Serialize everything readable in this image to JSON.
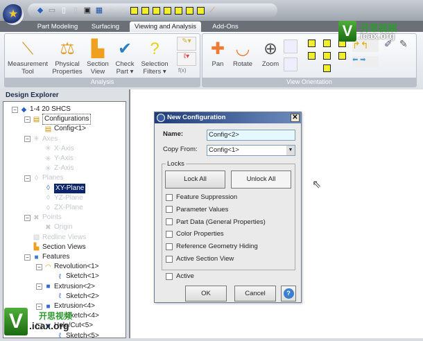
{
  "tabs": [
    {
      "label": "Part Modeling"
    },
    {
      "label": "Surfacing"
    },
    {
      "label": "Viewing and Analysis",
      "active": true
    },
    {
      "label": "Add-Ons"
    }
  ],
  "ribbon": {
    "analysis": {
      "label": "Analysis",
      "buttons": [
        {
          "label": "Measurement Tool",
          "icon": "ruler-icon"
        },
        {
          "label": "Physical Properties",
          "icon": "scale-icon"
        },
        {
          "label": "Section View",
          "icon": "section-view-icon"
        },
        {
          "label": "Check Part ▾",
          "icon": "check-part-icon"
        },
        {
          "label": "Selection Filters ▾",
          "icon": "question-icon"
        }
      ],
      "fx": "f(x)"
    },
    "view": {
      "label": "View Orientation",
      "buttons": [
        {
          "label": "Pan",
          "icon": "pan-icon"
        },
        {
          "label": "Rotate",
          "icon": "rotate-icon"
        },
        {
          "label": "Zoom",
          "icon": "zoom-icon"
        }
      ]
    }
  },
  "explorer": {
    "title": "Design Explorer",
    "items": [
      {
        "label": "1-4 20 SHCS",
        "level": 0,
        "icon": "part-icon"
      },
      {
        "label": "Configurations",
        "level": 1,
        "icon": "table-icon",
        "boxed": true
      },
      {
        "label": "Config<1>",
        "level": 2,
        "icon": "table-icon"
      },
      {
        "label": "Axes",
        "level": 1,
        "icon": "axis-icon",
        "dim": true
      },
      {
        "label": "X-Axis",
        "level": 2,
        "icon": "axis-icon",
        "dim": true
      },
      {
        "label": "Y-Axis",
        "level": 2,
        "icon": "axis-icon",
        "dim": true
      },
      {
        "label": "Z-Axis",
        "level": 2,
        "icon": "axis-icon",
        "dim": true
      },
      {
        "label": "Planes",
        "level": 1,
        "icon": "plane-icon",
        "dim": true
      },
      {
        "label": "XY-Plane",
        "level": 2,
        "icon": "plane-icon",
        "selected": true
      },
      {
        "label": "YZ-Plane",
        "level": 2,
        "icon": "plane-icon",
        "dim": true
      },
      {
        "label": "ZX-Plane",
        "level": 2,
        "icon": "plane-icon",
        "dim": true
      },
      {
        "label": "Points",
        "level": 1,
        "icon": "point-icon",
        "dim": true
      },
      {
        "label": "Origin",
        "level": 2,
        "icon": "point-icon",
        "dim": true
      },
      {
        "label": "Redline Views",
        "level": 1,
        "icon": "redline-icon",
        "dim": true
      },
      {
        "label": "Section Views",
        "level": 1,
        "icon": "section-icon"
      },
      {
        "label": "Features",
        "level": 1,
        "icon": "features-icon"
      },
      {
        "label": "Revolution<1>",
        "level": 2,
        "icon": "revolution-icon"
      },
      {
        "label": "Sketch<1>",
        "level": 3,
        "icon": "sketch-icon"
      },
      {
        "label": "Extrusion<2>",
        "level": 2,
        "icon": "extrusion-icon"
      },
      {
        "label": "Sketch<2>",
        "level": 3,
        "icon": "sketch-icon"
      },
      {
        "label": "Extrusion<4>",
        "level": 2,
        "icon": "extrusion-icon"
      },
      {
        "label": "Sketch<4>",
        "level": 3,
        "icon": "sketch-icon"
      },
      {
        "label": "Hole/Cut<5>",
        "level": 2,
        "icon": "hole-icon"
      },
      {
        "label": "Sketch<5>",
        "level": 3,
        "icon": "sketch-icon"
      }
    ]
  },
  "dialog": {
    "title": "New Configuration",
    "close": "✕",
    "name_label": "Name:",
    "name_value": "Config<2>",
    "copy_from_label": "Copy From:",
    "copy_from_value": "Config<1>",
    "locks_label": "Locks",
    "lock_all": "Lock All",
    "unlock_all": "Unlock All",
    "checks": [
      {
        "label": "Feature Suppression",
        "checked": false
      },
      {
        "label": "Parameter Values",
        "checked": false
      },
      {
        "label": "Part Data (General Properties)",
        "checked": false
      },
      {
        "label": "Color Properties",
        "checked": false
      },
      {
        "label": "Reference Geometry Hiding",
        "checked": false
      },
      {
        "label": "Active Section View",
        "checked": false
      }
    ],
    "active_label": "Active",
    "ok": "OK",
    "cancel": "Cancel",
    "help": "?"
  },
  "watermark": {
    "cn": "开思视频",
    "site": ".icax.org",
    "letter": "V"
  }
}
